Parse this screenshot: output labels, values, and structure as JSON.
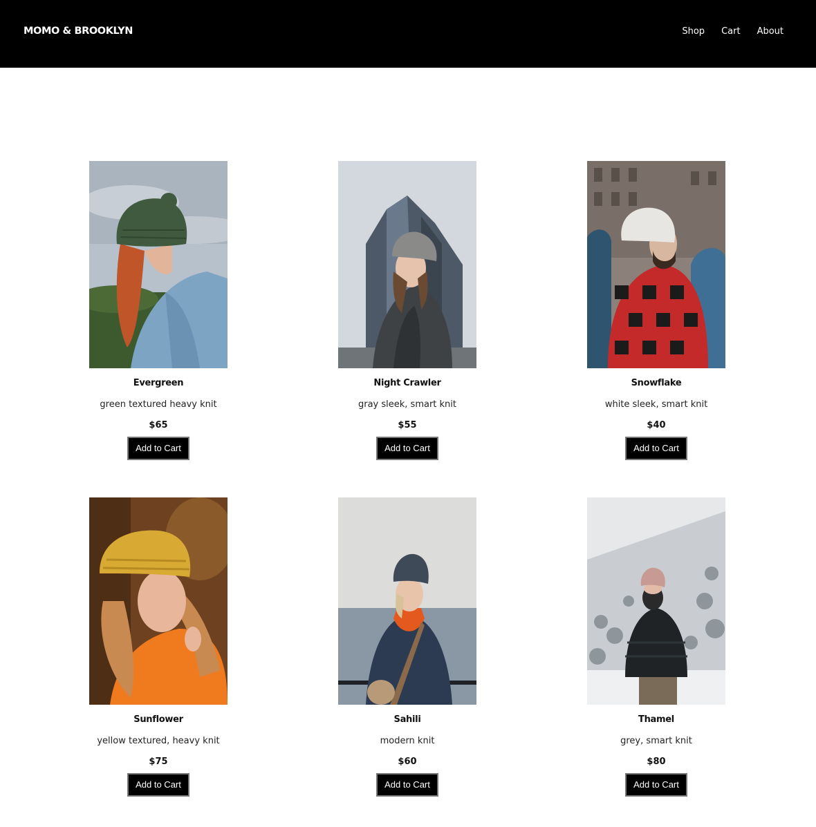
{
  "header": {
    "brand": "MOMO & BROOKLYN",
    "nav": [
      "Shop",
      "Cart",
      "About"
    ]
  },
  "products": [
    {
      "name": "Evergreen",
      "description": "green textured heavy knit",
      "price": "$65",
      "button": "Add to Cart",
      "hat_color": "#3f5a3e",
      "sky": "#b8c2cc"
    },
    {
      "name": "Night Crawler",
      "description": "gray sleek, smart knit",
      "price": "$55",
      "button": "Add to Cart",
      "hat_color": "#8a8a88",
      "sky": "#cfd6dc"
    },
    {
      "name": "Snowflake",
      "description": "white sleek, smart knit",
      "price": "$40",
      "button": "Add to Cart",
      "hat_color": "#e8e6e2",
      "sky": "#8a7f78"
    },
    {
      "name": "Sunflower",
      "description": "yellow textured, heavy knit",
      "price": "$75",
      "button": "Add to Cart",
      "hat_color": "#d8a933",
      "sky": "#7a4a22"
    },
    {
      "name": "Sahili",
      "description": "modern knit",
      "price": "$60",
      "button": "Add to Cart",
      "hat_color": "#3e4a57",
      "sky": "#d9dadb"
    },
    {
      "name": "Thamel",
      "description": "grey, smart knit",
      "price": "$80",
      "button": "Add to Cart",
      "hat_color": "#c79a94",
      "sky": "#e6e8ea"
    }
  ]
}
